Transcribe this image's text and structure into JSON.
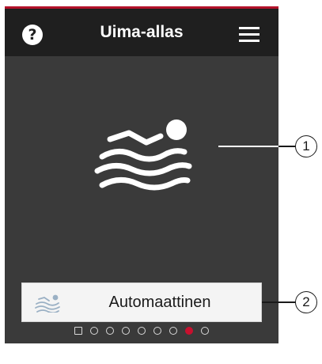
{
  "header": {
    "title": "Uima-allas",
    "help_glyph": "?",
    "help_icon": "help-circle-icon",
    "menu_icon": "hamburger-menu-icon"
  },
  "hero": {
    "icon": "swimmer-icon"
  },
  "mode": {
    "label": "Automaattinen",
    "icon": "swimmer-icon"
  },
  "pager": {
    "page_count": 9,
    "active_index": 7,
    "first_is_square": true
  },
  "callouts": [
    {
      "label": "1"
    },
    {
      "label": "2"
    }
  ],
  "colors": {
    "accent": "#c8102e",
    "header_bg": "#1f1f1f",
    "screen_bg": "#3a3a3a",
    "mode_icon": "#9ab0c4"
  }
}
